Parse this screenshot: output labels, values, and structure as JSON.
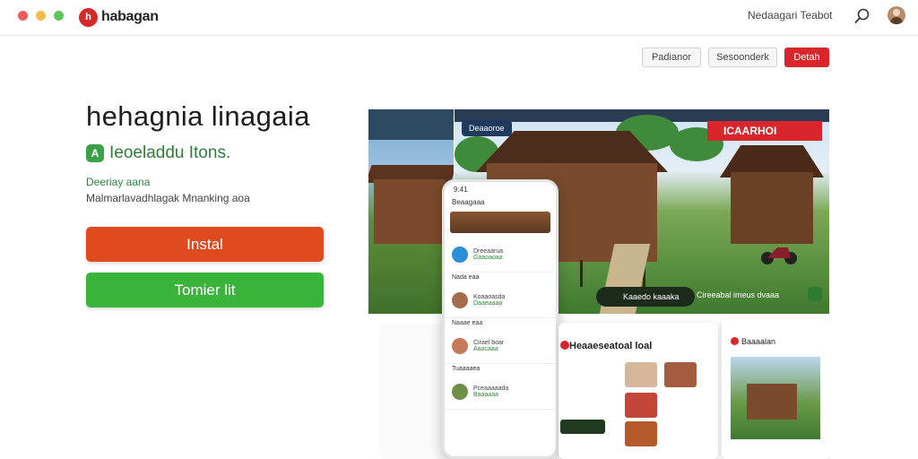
{
  "window": {
    "traffic_lights": [
      "#ee5a5a",
      "#f4bd4f",
      "#5cc75c"
    ]
  },
  "header": {
    "logo_badge": "h",
    "logo_text": "habagan",
    "nav_link": "Nedaagari Teabot",
    "search_icon": "search-icon",
    "avatar": "avatar"
  },
  "actions": {
    "btn1": "Padianor",
    "btn2": "Sesoonderk",
    "btn3": "Detah"
  },
  "hero": {
    "title": "hehagnia linagaia",
    "subtitle_icon": "A",
    "subtitle": "Ieoeladdu Itons.",
    "tagline": "Deeriay aana",
    "description": "Malmarlavadhlagak Mnanking aoa",
    "install_label": "Instal",
    "secondary_label": "Tomier lit"
  },
  "showcase": {
    "scene_pill": "Deaaoroe",
    "red_banner": "ICAARHOI",
    "caption": "Kaaedo kaaaka",
    "caption2": "Cireeabal imeus dvaaa",
    "phone_status": "9:41",
    "phone_header": "Beaagaaa",
    "chats": [
      {
        "name": "Dreeaarua",
        "sub": "Gaaoaoaa"
      },
      {
        "name": "Koaaoasda",
        "sub": "Daaeaaaa"
      },
      {
        "name": "Cirael boar",
        "sub": "Aaacaaa"
      },
      {
        "name": "Pceaaaaada",
        "sub": "Baaaaaa"
      }
    ],
    "phone_labels": [
      "Nada eaa",
      "Naaae eaa",
      "Tuaaaaea"
    ],
    "card_mid_title": "Heaaeseatoal loal",
    "card_right_title": "Baaaalan"
  },
  "colors": {
    "accent_red": "#d9262c",
    "install_orange": "#e04a1e",
    "secondary_green": "#3ab43a"
  }
}
